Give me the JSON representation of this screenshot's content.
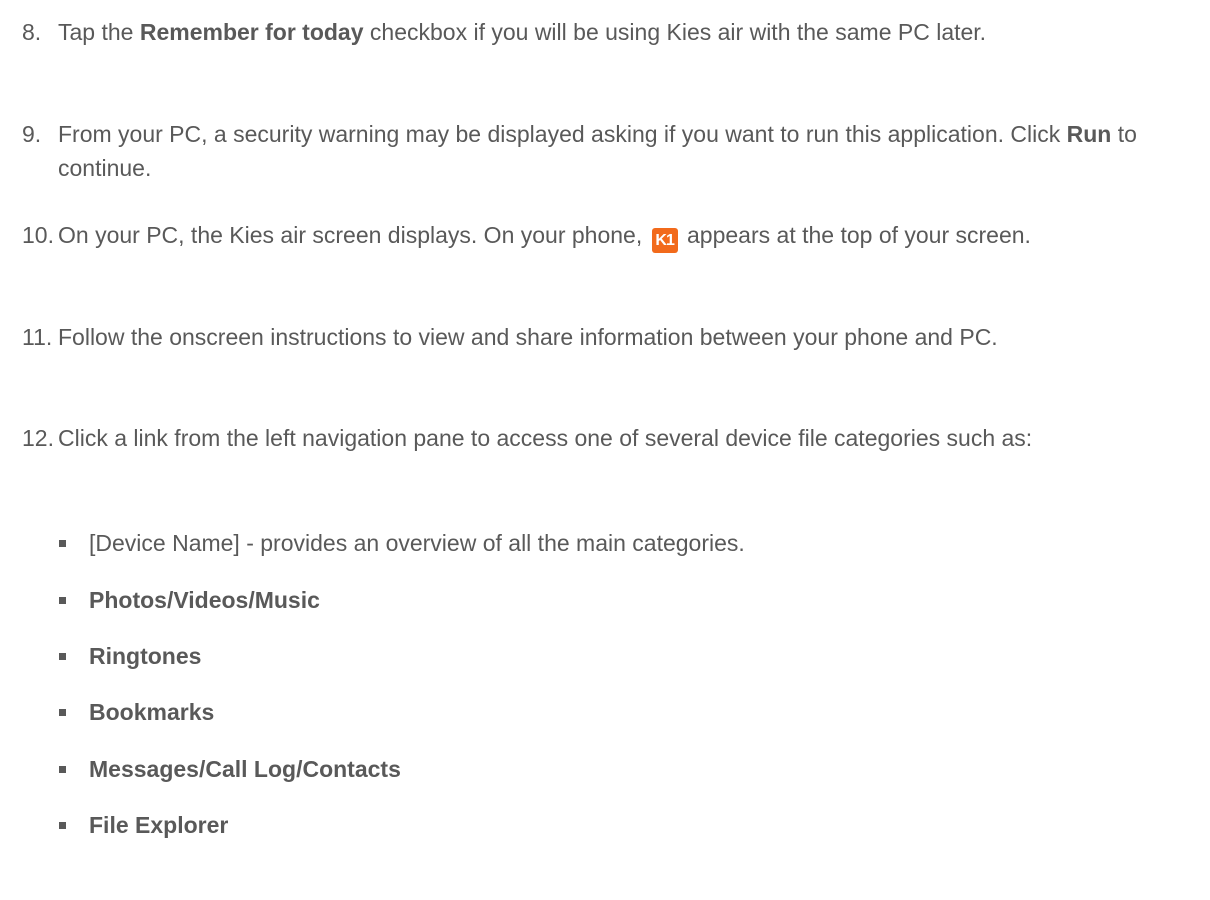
{
  "steps": [
    {
      "number": "8.",
      "parts": [
        "Tap the ",
        "Remember for today",
        " checkbox if you will be using Kies air with the same PC later."
      ]
    },
    {
      "number": "9.",
      "parts": [
        "From your PC, a security warning may be displayed asking if you want to run this application. Click ",
        "Run",
        " to continue."
      ]
    },
    {
      "number": "10.",
      "parts": [
        "On your PC, the Kies air screen displays. On your phone, ",
        " appears at the top of your screen."
      ],
      "icon": {
        "name": "kies-air-icon",
        "glyph": "K1",
        "color": "#f26a1b"
      }
    },
    {
      "number": "11.",
      "text": "Follow the onscreen instructions to view and share information between your phone and PC."
    },
    {
      "number": "12.",
      "text": "Click a link from the left navigation pane to access one of several device file categories such as:"
    }
  ],
  "categories": [
    {
      "text": "[Device Name] - provides an overview of all the main categories.",
      "bold": false
    },
    {
      "text": "Photos/Videos/Music",
      "bold": true
    },
    {
      "text": "Ringtones",
      "bold": true
    },
    {
      "text": "Bookmarks",
      "bold": true
    },
    {
      "text": "Messages/Call Log/Contacts",
      "bold": true
    },
    {
      "text": "File Explorer",
      "bold": true
    }
  ]
}
